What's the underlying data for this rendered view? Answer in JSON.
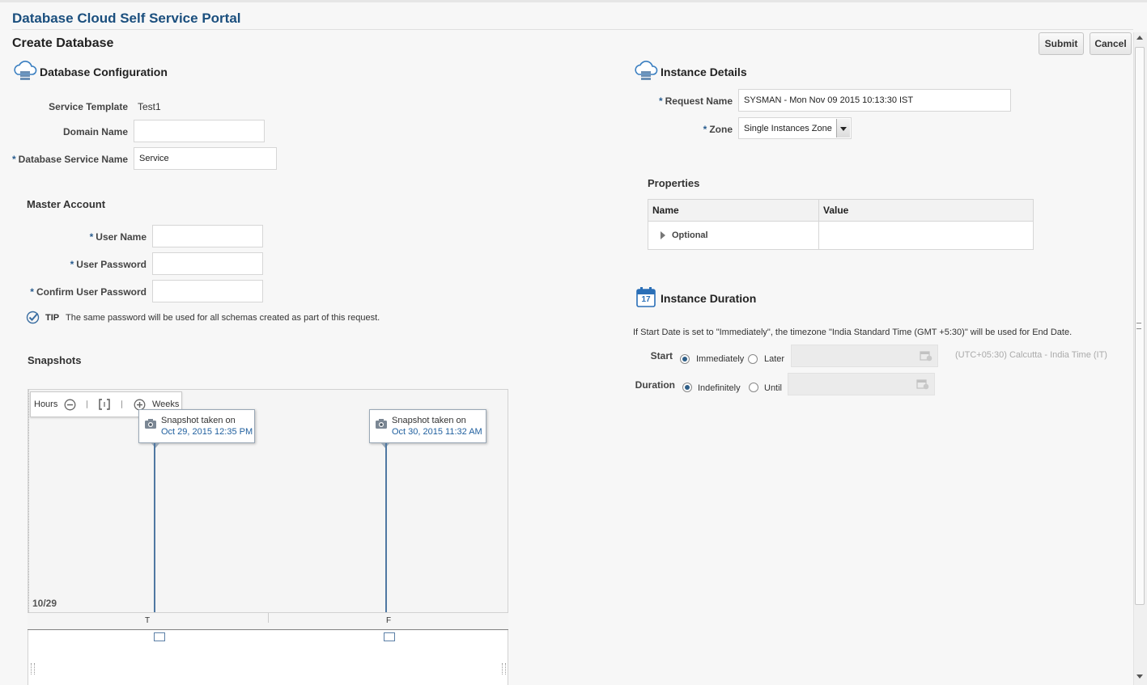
{
  "app": {
    "title": "Database Cloud Self Service Portal"
  },
  "page": {
    "title": "Create Database"
  },
  "actions": {
    "submit": "Submit",
    "cancel": "Cancel"
  },
  "db_config": {
    "title": "Database Configuration",
    "service_template_label": "Service Template",
    "service_template_value": "Test1",
    "domain_name_label": "Domain Name",
    "domain_name_value": "",
    "db_service_name_label": "Database Service Name",
    "db_service_name_value": "Service"
  },
  "master_account": {
    "title": "Master Account",
    "user_name_label": "User Name",
    "user_password_label": "User Password",
    "confirm_password_label": "Confirm User Password",
    "tip_label": "TIP",
    "tip_text": "The same password will be used for all schemas created as part of this request."
  },
  "snapshots": {
    "title": "Snapshots",
    "toolbar": {
      "hours": "Hours",
      "weeks": "Weeks"
    },
    "events": [
      {
        "line1": "Snapshot taken on",
        "line2": "Oct 29, 2015 12:35 PM"
      },
      {
        "line1": "Snapshot taken on",
        "line2": "Oct 30, 2015 11:32 AM"
      }
    ],
    "date_label": "10/29",
    "axis_ticks": [
      "T",
      "F"
    ]
  },
  "instance_details": {
    "title": "Instance Details",
    "request_name_label": "Request Name",
    "request_name_value": "SYSMAN - Mon Nov 09 2015 10:13:30 IST",
    "zone_label": "Zone",
    "zone_value": "Single Instances Zone"
  },
  "properties": {
    "title": "Properties",
    "columns": [
      "Name",
      "Value"
    ],
    "rows": [
      {
        "name": "Optional",
        "value": ""
      }
    ]
  },
  "instance_duration": {
    "title": "Instance Duration",
    "calendar_day": "17",
    "note": "If Start Date is set to \"Immediately\", the timezone \"India Standard Time (GMT +5:30)\" will be used for End Date.",
    "start_label": "Start",
    "start_options": [
      "Immediately",
      "Later"
    ],
    "start_selected": "Immediately",
    "timezone_text": "(UTC+05:30) Calcutta - India Time (IT)",
    "duration_label": "Duration",
    "duration_options": [
      "Indefinitely",
      "Until"
    ],
    "duration_selected": "Indefinitely"
  },
  "colors": {
    "title_blue": "#1b4f7e",
    "link_blue": "#1f5f9e",
    "accent": "#2e5e87"
  }
}
